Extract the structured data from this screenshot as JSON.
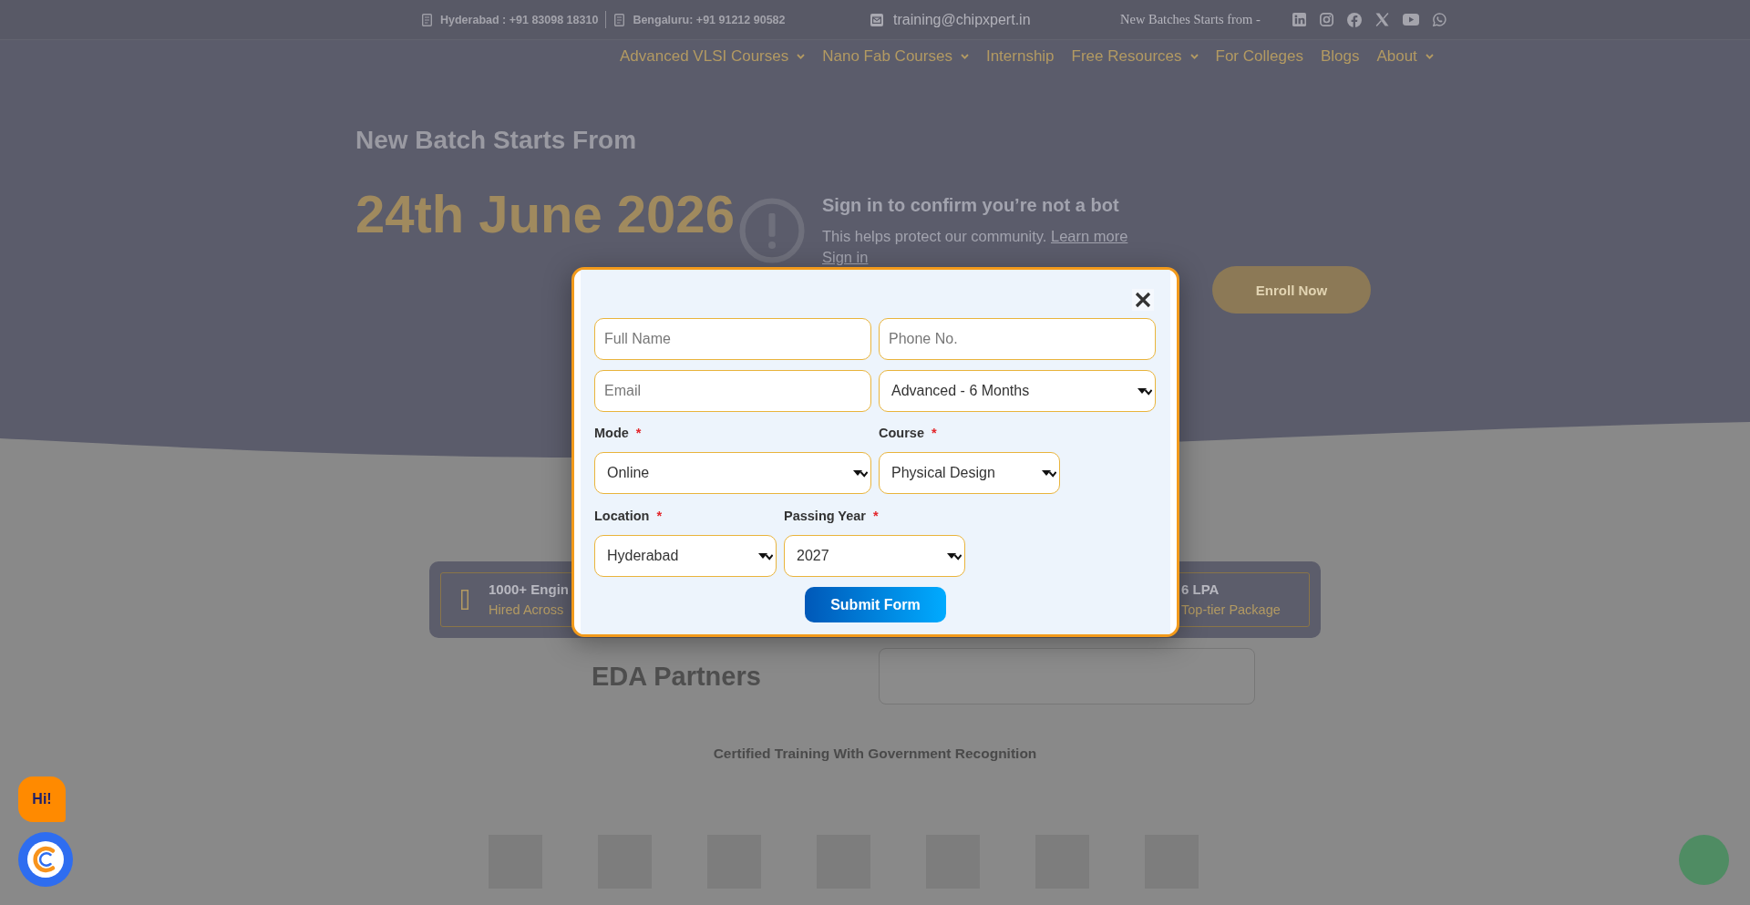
{
  "top_bar": {
    "phones": [
      "Hyderabad : +91 83098 18310",
      "Bengaluru: +91 91212 90582"
    ],
    "email": "training@chipxpert.in",
    "batch_notice": "New Batches Starts from -"
  },
  "nav": {
    "items": [
      {
        "label": "Advanced VLSI Courses",
        "dropdown": true
      },
      {
        "label": "Nano Fab Courses",
        "dropdown": true
      },
      {
        "label": "Internship",
        "dropdown": false
      },
      {
        "label": "Free Resources",
        "dropdown": true
      },
      {
        "label": "For Colleges",
        "dropdown": false
      },
      {
        "label": "Blogs",
        "dropdown": false
      },
      {
        "label": "About",
        "dropdown": true
      }
    ]
  },
  "hero": {
    "subtitle": "New Batch Starts From",
    "date": "24th June 2026",
    "enroll_button": "Enroll Now"
  },
  "video_embed": {
    "title": "Sign in to confirm you’re not a bot",
    "message": "This helps protect our community.",
    "learn_more_link": "Learn more",
    "sign_in_link": "Sign in"
  },
  "stats": [
    {
      "title": "1000+ Engin",
      "subtitle": "Hired Across",
      "show_icon": true
    },
    {
      "title": "6 LPA",
      "subtitle": "Top-tier Package",
      "show_icon": false
    }
  ],
  "partners": {
    "heading": "EDA Partners"
  },
  "recognition": {
    "heading": "Certified Training With Government Recognition"
  },
  "enquiry_form": {
    "rows": [
      {
        "fields": [
          {
            "kind": "text",
            "placeholder": "Full Name"
          },
          {
            "kind": "text",
            "placeholder": "Phone No."
          }
        ]
      },
      {
        "fields": [
          {
            "kind": "text",
            "placeholder": "Email"
          },
          {
            "kind": "select",
            "value": "Advanced - 6 Months"
          }
        ]
      },
      {
        "fields": [
          {
            "kind": "select",
            "label": "Mode",
            "required_mark": "*",
            "value": "Online"
          },
          {
            "kind": "select",
            "label": "Course",
            "required_mark": "*",
            "value": "Physical Design"
          }
        ]
      },
      {
        "fields": [
          {
            "kind": "select",
            "label": "Location",
            "required_mark": "*",
            "value": "Hyderabad"
          },
          {
            "kind": "select",
            "label": "Passing Year",
            "required_mark": "*",
            "value": "2027"
          }
        ]
      }
    ],
    "submit_button": "Submit Form"
  },
  "chat_widget": {
    "greeting": "Hi!"
  }
}
